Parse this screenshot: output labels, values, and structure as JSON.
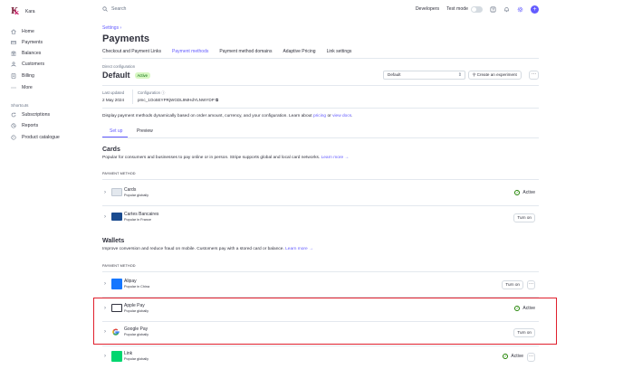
{
  "brand": {
    "name": "Kara"
  },
  "sidebar": {
    "items": [
      {
        "label": "Home",
        "icon": "home-icon"
      },
      {
        "label": "Payments",
        "icon": "card-icon"
      },
      {
        "label": "Balances",
        "icon": "bank-icon"
      },
      {
        "label": "Customers",
        "icon": "person-icon"
      },
      {
        "label": "Billing",
        "icon": "billing-icon"
      },
      {
        "label": "More",
        "icon": "dots-icon"
      }
    ],
    "shortcuts_label": "Shortcuts",
    "shortcuts": [
      {
        "label": "Subscriptions",
        "icon": "refresh-icon"
      },
      {
        "label": "Reports",
        "icon": "report-icon"
      },
      {
        "label": "Product catalogue",
        "icon": "catalogue-icon"
      }
    ]
  },
  "topbar": {
    "search_placeholder": "Search",
    "developers": "Developers",
    "test_mode": "Test mode"
  },
  "breadcrumb": "Settings",
  "page_title": "Payments",
  "tabs": [
    "Checkout and Payment Links",
    "Payment methods",
    "Payment method domains",
    "Adaptive Pricing",
    "Link settings"
  ],
  "config": {
    "direct_label": "Direct configuration",
    "title": "Default",
    "badge": "Active",
    "select_value": "Default",
    "create_experiment": "Create an experiment",
    "last_updated_label": "Last updated",
    "last_updated_value": "2 May 2024",
    "configuration_label": "Configuration",
    "configuration_value": "pmc_1Oo5EYPRjWGDL9MHdYLNWYDP"
  },
  "description": {
    "text": "Display payment methods dynamically based on order amount, currency, and your configuration. Learn about",
    "link1": "pricing",
    "or": "or",
    "link2": "view docs",
    "end": "."
  },
  "subtabs": [
    "Set up",
    "Preview"
  ],
  "cards": {
    "title": "Cards",
    "desc": "Popular for consumers and businesses to pay online or in person. Stripe supports global and local card networks.",
    "learn_more": "Learn more →",
    "header": "PAYMENT METHOD",
    "rows": [
      {
        "name": "Cards",
        "sub": "Popular globally",
        "status": "Active"
      },
      {
        "name": "Cartes Bancaires",
        "sub": "Popular in France",
        "action": "Turn on"
      }
    ]
  },
  "wallets": {
    "title": "Wallets",
    "desc": "Improve conversion and reduce fraud on mobile. Customers pay with a stored card or balance.",
    "learn_more": "Learn more →",
    "header": "PAYMENT METHOD",
    "rows": [
      {
        "name": "Alipay",
        "sub": "Popular in China",
        "action": "Turn on"
      },
      {
        "name": "Apple Pay",
        "sub": "Popular globally",
        "status": "Active"
      },
      {
        "name": "Google Pay",
        "sub": "Popular globally",
        "action": "Turn on"
      },
      {
        "name": "Link",
        "sub": "Popular globally",
        "status": "Active"
      }
    ]
  },
  "colors": {
    "accent": "#635bff",
    "active_green": "#228403",
    "highlight_red": "#e01f2c"
  }
}
